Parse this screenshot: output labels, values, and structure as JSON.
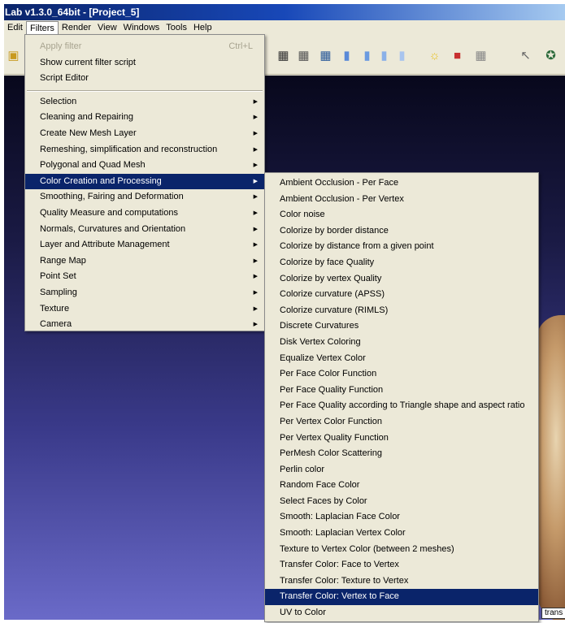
{
  "window": {
    "title": "Lab v1.3.0_64bit - [Project_5]"
  },
  "menubar": [
    "Edit",
    "Filters",
    "Render",
    "View",
    "Windows",
    "Tools",
    "Help"
  ],
  "toolbar": {
    "icons": [
      "open-icon",
      "mesh-view-icon",
      "mesh-view-icon",
      "mesh-view-icon",
      "shade-icon",
      "shade-icon",
      "shade-icon",
      "shade-icon",
      "light-icon",
      "color-icon",
      "texture-icon",
      "select-icon",
      "measure-icon"
    ]
  },
  "filters_menu": {
    "top_items": [
      {
        "label": "Apply filter",
        "shortcut": "Ctrl+L",
        "disabled": true
      },
      {
        "label": "Show current filter script"
      },
      {
        "label": "Script Editor"
      }
    ],
    "submenus": [
      "Selection",
      "Cleaning and Repairing",
      "Create New Mesh Layer",
      "Remeshing, simplification and reconstruction",
      "Polygonal and Quad Mesh",
      "Color Creation and Processing",
      "Smoothing, Fairing and Deformation",
      "Quality Measure and computations",
      "Normals, Curvatures and Orientation",
      "Layer and Attribute Management",
      "Range Map",
      "Point Set",
      "Sampling",
      "Texture",
      "Camera"
    ],
    "highlighted": "Color Creation and Processing"
  },
  "color_submenu": {
    "items": [
      "Ambient Occlusion - Per Face",
      "Ambient Occlusion - Per Vertex",
      "Color noise",
      "Colorize by border distance",
      "Colorize by distance from a given point",
      "Colorize by face Quality",
      "Colorize by vertex Quality",
      "Colorize curvature (APSS)",
      "Colorize curvature (RIMLS)",
      "Discrete Curvatures",
      "Disk Vertex Coloring",
      "Equalize Vertex Color",
      "Per Face Color Function",
      "Per Face Quality Function",
      "Per Face Quality according to Triangle shape and aspect ratio",
      "Per Vertex Color Function",
      "Per Vertex Quality Function",
      "PerMesh Color Scattering",
      "Perlin color",
      "Random Face Color",
      "Select Faces by Color",
      "Smooth: Laplacian Face Color",
      "Smooth: Laplacian Vertex Color",
      "Texture to Vertex Color (between 2 meshes)",
      "Transfer Color: Face to Vertex",
      "Transfer Color: Texture to Vertex",
      "Transfer Color: Vertex to Face",
      "UV to Color"
    ],
    "highlighted": "Transfer Color: Vertex to Face"
  },
  "status_tag": "trans",
  "colors": {
    "highlight": "#0a246a",
    "menu_bg": "#ece9d8",
    "title_start": "#0a246a"
  }
}
